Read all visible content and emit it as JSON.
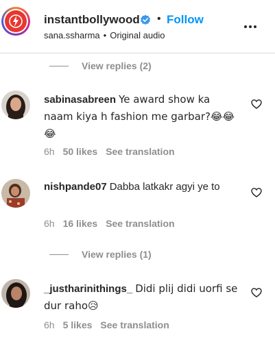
{
  "post": {
    "username": "instantbollywood",
    "follow_label": "Follow",
    "dot": "•",
    "subline_user": "sana.ssharma",
    "subline_sep": "•",
    "subline_audio": "Original audio"
  },
  "replies_top": {
    "label": "View replies (2)"
  },
  "comments": [
    {
      "username": "sabinasabreen",
      "text": "Ye award show ka naam kiya h fashion me garbar?😂😂😂",
      "time": "6h",
      "likes": "50 likes",
      "translate": "See translation"
    },
    {
      "username": "nishpande07",
      "text": "Dabba latkakr agyi ye to",
      "time": "6h",
      "likes": "16 likes",
      "translate": "See translation"
    },
    {
      "username": "_justharinithings_",
      "text": "Didi plij didi uorfi se dur raho😥",
      "time": "6h",
      "likes": "5 likes",
      "translate": "See translation"
    }
  ],
  "replies_mid": {
    "label": "View replies (1)"
  },
  "colors": {
    "accent": "#0095f6",
    "verified": "#3897f0",
    "muted": "#8e8e8e",
    "text": "#262626"
  }
}
